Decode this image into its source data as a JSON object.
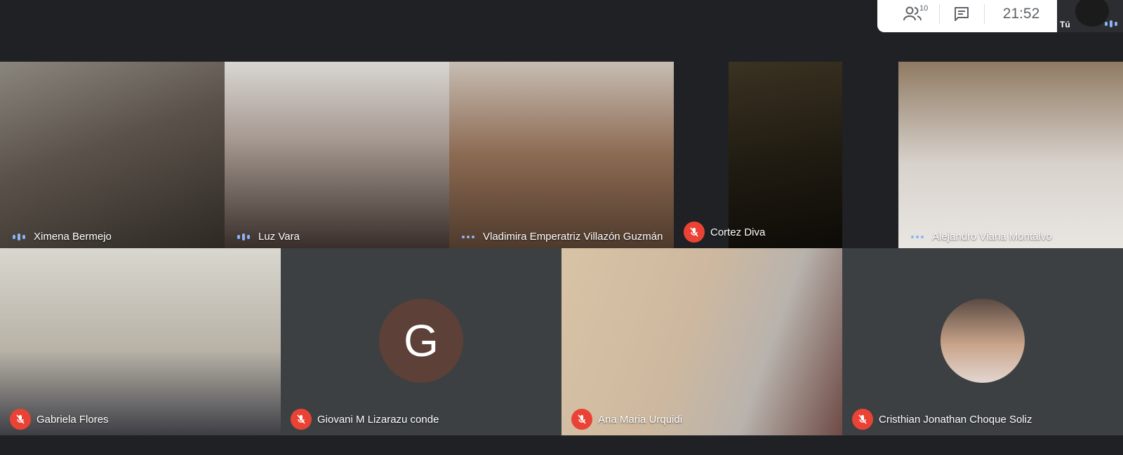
{
  "topbar": {
    "people_count": "10",
    "time": "21:52",
    "self_label": "Tú"
  },
  "icons": {
    "people": "people-icon",
    "chat": "chat-icon",
    "mic_off": "mic-off-icon",
    "audio_dots": "audio-level-icon"
  },
  "participants": [
    {
      "name": "Ximena Bermejo",
      "muted": false,
      "talking": true
    },
    {
      "name": "Luz Vara",
      "muted": false,
      "talking": true
    },
    {
      "name": "Vladimira Emperatriz Villazón Guzmán",
      "muted": false,
      "talking": false
    },
    {
      "name": "Cortez Diva",
      "muted": true,
      "talking": false
    },
    {
      "name": "Alejandro Viana Montalvo",
      "muted": false,
      "talking": false
    },
    {
      "name": "Gabriela Flores",
      "muted": true,
      "talking": false
    },
    {
      "name": "Giovani M Lizarazu conde",
      "muted": true,
      "talking": false,
      "avatar_letter": "G"
    },
    {
      "name": "Ana Maria Urquidi",
      "muted": true,
      "talking": false
    },
    {
      "name": "Cristhian Jonathan Choque Soliz",
      "muted": true,
      "talking": false
    }
  ],
  "colors": {
    "background": "#202124",
    "mute_red": "#ea4335",
    "audio_blue": "#8ab4f8",
    "avatar_brown": "#5d4037"
  }
}
